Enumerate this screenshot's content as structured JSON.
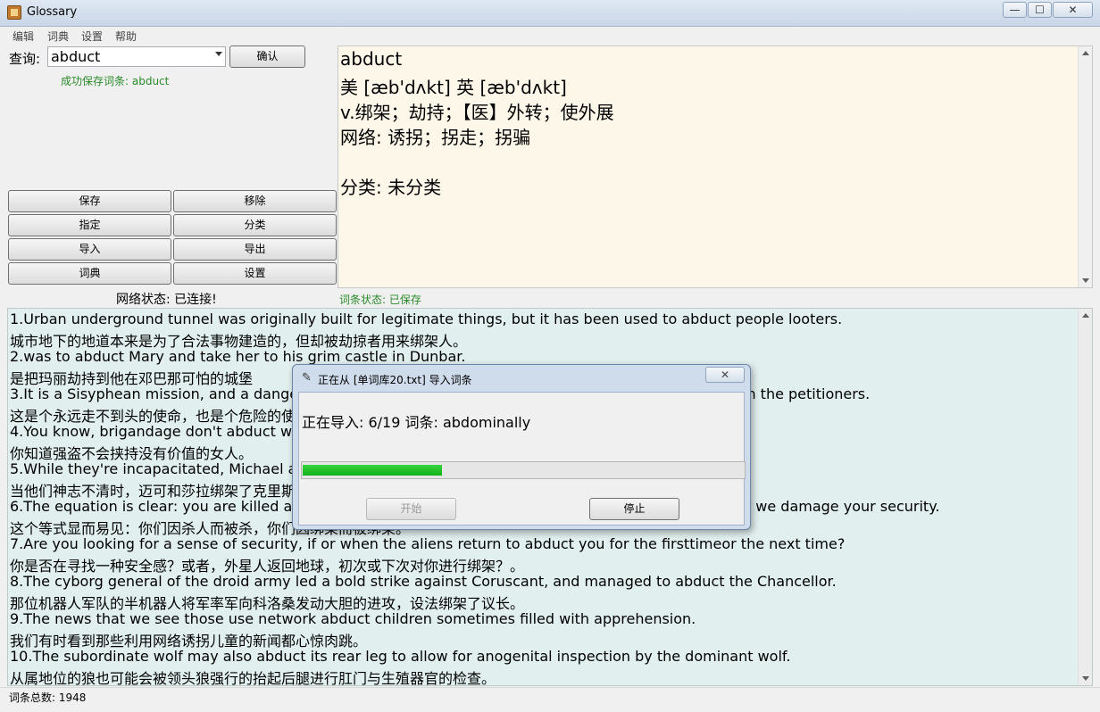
{
  "window": {
    "title": "Glossary",
    "min": "—",
    "max": "☐",
    "close": "✕"
  },
  "menu": [
    "编辑",
    "词典",
    "设置",
    "帮助"
  ],
  "query": {
    "label": "查询:",
    "value": "abduct",
    "confirm": "确认",
    "save_message": "成功保存词条: abduct"
  },
  "buttons": [
    [
      "保存",
      "移除"
    ],
    [
      "指定",
      "分类"
    ],
    [
      "导入",
      "导出"
    ],
    [
      "词典",
      "设置"
    ]
  ],
  "network_status": "网络状态: 已连接!",
  "definition": {
    "word": "abduct",
    "phonetic": "美 [æb'dʌkt] 英 [æb'dʌkt]",
    "meaning": "v.绑架；劫持；【医】外转；使外展",
    "web": "网络: 诱拐；拐走；拐骗",
    "category": "分类: 未分类"
  },
  "entry_status": "词条状态: 已保存",
  "examples": [
    "1.Urban underground tunnel was originally built for legitimate things, but it has been used to abduct people looters.",
    "城市地下的地道本来是为了合法事物建造的，但却被劫掠者用来绑架人。",
    "2.was to abduct Mary and take her to his grim castle in Dunbar.",
    "是把玛丽劫持到他在邓巴那可怕的城堡",
    "3.It is a Sisyphean mission, and a dangerous one, since the authorities send thugs to abduct and punish the petitioners.",
    "这是个永远走不到头的使命，也是个危险的使命。",
    "4.You know, brigandage don't abduct worthless women.",
    "你知道强盗不会挟持没有价值的女人。",
    "5.While they're incapacitated, Michael and Sara abduct Christina.",
    "当他们神志不清时，迈可和莎拉绑架了克里斯蒂娜。",
    "6.The equation is clear: you are killed as you kill, you are abducted as you abduct, you are damaged as we damage your security.",
    "这个等式显而易见：你们因杀人而被杀，你们因绑架而被绑架。",
    "7.Are you looking for a sense of security, if or when the aliens return to abduct you for the firsttimeor the next time?",
    "你是否在寻找一种安全感？或者，外星人返回地球，初次或下次对你进行绑架？。",
    "8.The cyborg general of the droid army led a bold strike against Coruscant, and managed to abduct the Chancellor.",
    "那位机器人军队的半机器人将军率军向科洛桑发动大胆的进攻，设法绑架了议长。",
    "9.The news that we see those use network abduct children sometimes filled with apprehension.",
    "我们有时看到那些利用网络诱拐儿童的新闻都心惊肉跳。",
    "10.The subordinate wolf may also abduct its rear leg to allow for anogenital inspection by the dominant wolf.",
    "从属地位的狼也可能会被领头狼强行的抬起后腿进行肛门与生殖器官的检查。"
  ],
  "total": "词条总数: 1948",
  "dialog": {
    "title": "正在从 [单词库20.txt] 导入词条",
    "close": "✕",
    "message": "正在导入: 6/19  词条: abdominally",
    "progress": 0.315,
    "start": "开始",
    "stop": "停止"
  }
}
